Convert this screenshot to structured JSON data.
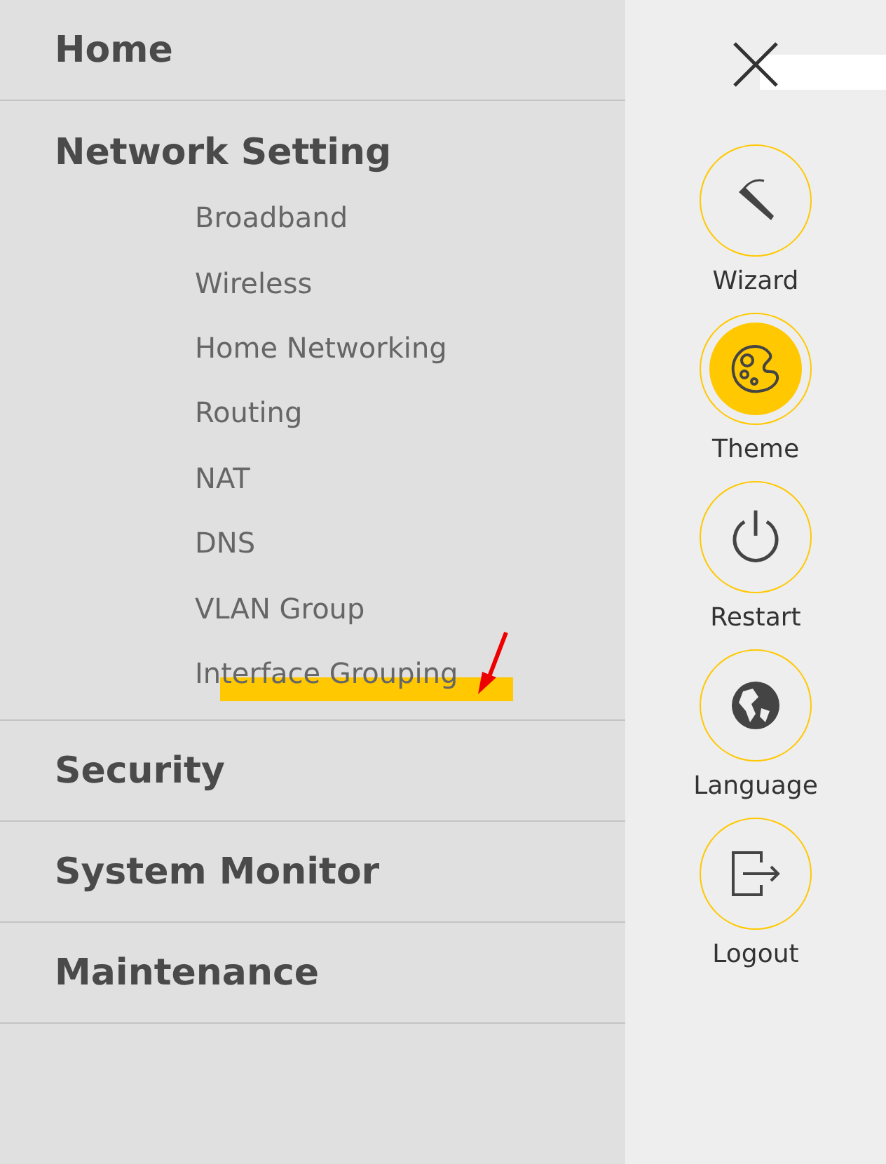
{
  "menu": [
    {
      "label": "Home",
      "expanded": false
    },
    {
      "label": "Network Setting",
      "expanded": true,
      "children": [
        {
          "label": "Broadband",
          "highlighted": false,
          "pointer": false
        },
        {
          "label": "Wireless",
          "highlighted": false,
          "pointer": false
        },
        {
          "label": "Home Networking",
          "highlighted": false,
          "pointer": false
        },
        {
          "label": "Routing",
          "highlighted": false,
          "pointer": false
        },
        {
          "label": "NAT",
          "highlighted": false,
          "pointer": false
        },
        {
          "label": "DNS",
          "highlighted": false,
          "pointer": false
        },
        {
          "label": "VLAN Group",
          "highlighted": false,
          "pointer": false
        },
        {
          "label": "Interface Grouping",
          "highlighted": true,
          "pointer": true
        }
      ]
    },
    {
      "label": "Security",
      "expanded": false
    },
    {
      "label": "System Monitor",
      "expanded": false
    },
    {
      "label": "Maintenance",
      "expanded": false
    }
  ],
  "actions": [
    {
      "kind": "wizard",
      "label": "Wizard",
      "selected": false
    },
    {
      "kind": "theme",
      "label": "Theme",
      "selected": true
    },
    {
      "kind": "restart",
      "label": "Restart",
      "selected": false
    },
    {
      "kind": "language",
      "label": "Language",
      "selected": false
    },
    {
      "kind": "logout",
      "label": "Logout",
      "selected": false
    }
  ]
}
